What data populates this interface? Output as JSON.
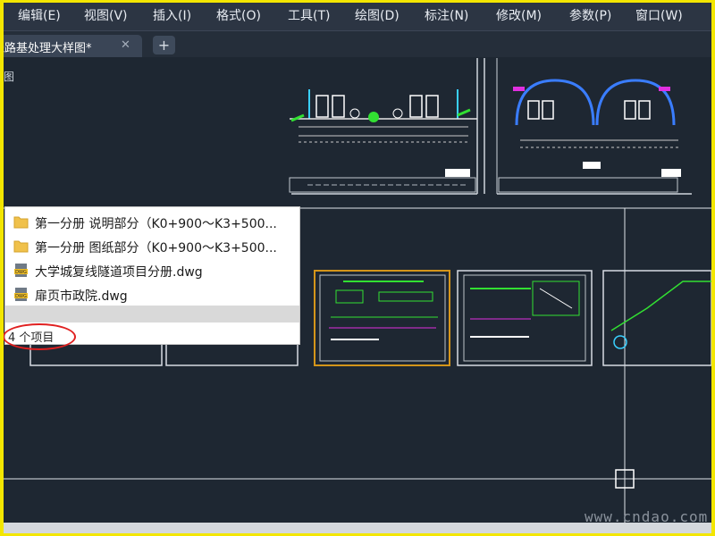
{
  "menu": {
    "items": [
      {
        "label": "编辑(E)"
      },
      {
        "label": "视图(V)"
      },
      {
        "label": "插入(I)"
      },
      {
        "label": "格式(O)"
      },
      {
        "label": "工具(T)"
      },
      {
        "label": "绘图(D)"
      },
      {
        "label": "标注(N)"
      },
      {
        "label": "修改(M)"
      },
      {
        "label": "参数(P)"
      },
      {
        "label": "窗口(W)"
      }
    ]
  },
  "tabs": {
    "active_label": "线路基处理大样图*",
    "close_glyph": "✕",
    "new_glyph": "+"
  },
  "viewport": {
    "label": "图"
  },
  "popup": {
    "files": [
      {
        "name": "第一分册 说明部分（K0+900～K3+500...",
        "icon": "folder-icon"
      },
      {
        "name": "第一分册 图纸部分（K0+900～K3+500...",
        "icon": "folder-icon"
      },
      {
        "name": "大学城复线隧道项目分册.dwg",
        "icon": "dwg-file-icon"
      },
      {
        "name": "扉页市政院.dwg",
        "icon": "dwg-file-icon"
      }
    ],
    "count_text": "4 个项目",
    "dwg_badge": "DWG"
  },
  "watermark": "www.cndao.com",
  "colors": {
    "background": "#1e2732",
    "accent_highlight": "#e02020",
    "selected_sheet": "#d4951a"
  }
}
